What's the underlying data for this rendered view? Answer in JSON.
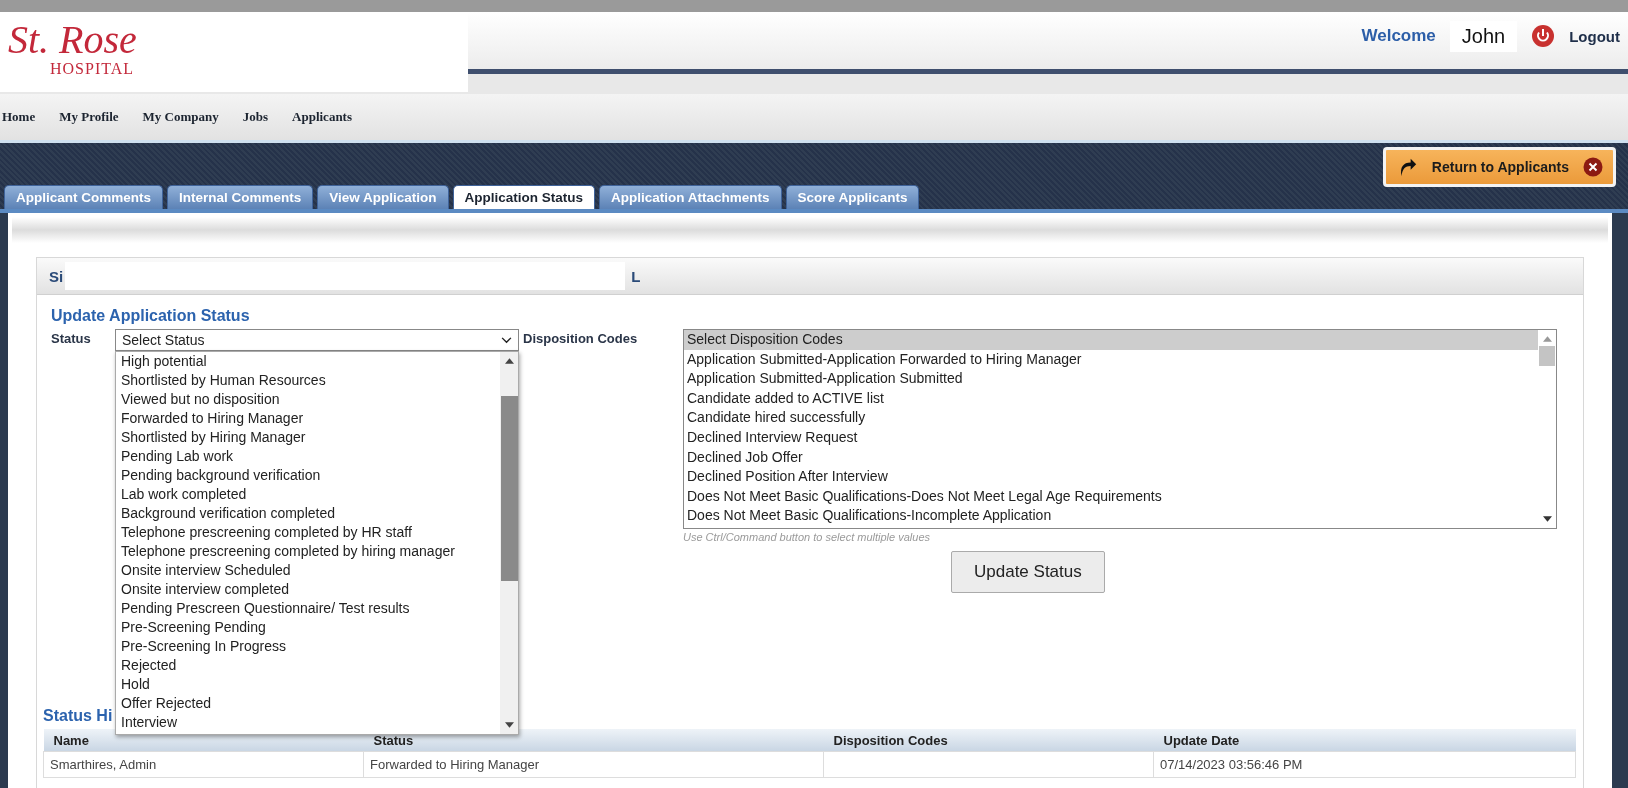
{
  "logo": {
    "name": "St. Rose",
    "sub": "HOSPITAL"
  },
  "user": {
    "welcome": "Welcome",
    "name": "John",
    "logout": "Logout"
  },
  "nav": [
    "Home",
    "My Profile",
    "My Company",
    "Jobs",
    "Applicants"
  ],
  "return_button": "Return to Applicants",
  "tabs": [
    {
      "label": "Applicant Comments",
      "selected": false
    },
    {
      "label": "Internal Comments",
      "selected": false
    },
    {
      "label": "View Application",
      "selected": false
    },
    {
      "label": "Application Status",
      "selected": true
    },
    {
      "label": "Application Attachments",
      "selected": false
    },
    {
      "label": "Score Applicants",
      "selected": false
    }
  ],
  "panel_header": {
    "start": "Si",
    "end": "L"
  },
  "section_title": "Update Application Status",
  "status_label": "Status",
  "status_select": {
    "value": "Select Status",
    "expanded": true,
    "options": [
      "High potential",
      "Shortlisted by Human Resources",
      "Viewed but no disposition",
      "Forwarded to Hiring Manager",
      "Shortlisted by Hiring Manager",
      "Pending Lab work",
      "Pending background verification",
      "Lab work completed",
      "Background verification completed",
      "Telephone prescreening completed by HR staff",
      "Telephone prescreening completed by hiring manager",
      "Onsite interview Scheduled",
      "Onsite interview completed",
      "Pending Prescreen Questionnaire/ Test results",
      "Pre-Screening Pending",
      "Pre-Screening In Progress",
      "Rejected",
      "Hold",
      "Offer Rejected",
      "Interview"
    ]
  },
  "disposition_label": "Disposition Codes",
  "disposition_list": [
    {
      "label": "Select Disposition Codes",
      "selected": true
    },
    {
      "label": "Application Submitted-Application Forwarded to Hiring Manager",
      "selected": false
    },
    {
      "label": "Application Submitted-Application Submitted",
      "selected": false
    },
    {
      "label": "Candidate added to ACTIVE list",
      "selected": false
    },
    {
      "label": "Candidate hired successfully",
      "selected": false
    },
    {
      "label": "Declined Interview Request",
      "selected": false
    },
    {
      "label": "Declined Job Offer",
      "selected": false
    },
    {
      "label": "Declined Position After Interview",
      "selected": false
    },
    {
      "label": "Does Not Meet Basic Qualifications-Does Not Meet Legal Age Requirements",
      "selected": false
    },
    {
      "label": "Does Not Meet Basic Qualifications-Incomplete Application",
      "selected": false
    }
  ],
  "disposition_hint": "Use Ctrl/Command button to select multiple values",
  "update_button": "Update Status",
  "history": {
    "title": "Status Hi",
    "columns": [
      "Name",
      "Status",
      "Disposition Codes",
      "Update Date"
    ],
    "rows": [
      [
        "Smarthires, Admin",
        "Forwarded to Hiring Manager",
        "",
        "07/14/2023 03:56:46 PM"
      ]
    ]
  }
}
